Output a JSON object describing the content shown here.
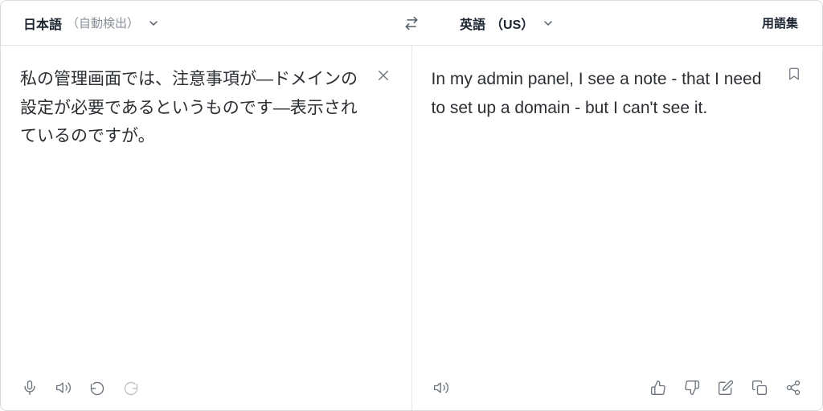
{
  "source": {
    "language_label": "日本語",
    "detect_label": "（自動検出）",
    "text": "私の管理画面では、注意事項が―ドメインの設定が必要であるというものです―表示されているのですが。"
  },
  "target": {
    "language_label": "英語",
    "region_label": "（US）",
    "text": "In my admin panel, I see a note - that I need to set up a domain - but I can't see it."
  },
  "glossary_label": "用語集"
}
